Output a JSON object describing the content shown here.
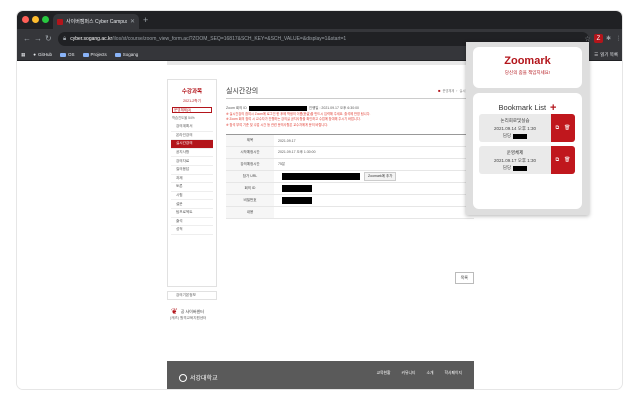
{
  "browser": {
    "tab_title": "사이버캠퍼스 Cyber Campus Syst",
    "url_host": "cyber.sogang.ac.kr",
    "url_path": "/ilos/st/course/zoom_view_form.acl?ZOOM_SEQ=16817&SCH_KEY=&SCH_VALUE=&display=1&start=1",
    "bookmarks": [
      "GitHub",
      "OS",
      "Projects",
      "Sogang"
    ],
    "reading_list": "읽기 목록"
  },
  "sidebar": {
    "title": "수강과목",
    "year_label": "2021-2학기",
    "course_select": "운영체제(3)",
    "sub": "학습진도율 54%",
    "items": [
      "강의계획서",
      "온라인강의",
      "실시간강의",
      "공지사항",
      "강의자료",
      "질의응답",
      "과제",
      "토론",
      "시험",
      "설문",
      "팀프로젝트",
      "출석",
      "성적"
    ],
    "active_index": 2,
    "box2": "강의기본정보",
    "cyber_title": "공 사이버센터",
    "cyber_sub": "(캐츠)  원격교육지원센터"
  },
  "content": {
    "title": "실시간강의",
    "crumbs": [
      "운영체제",
      "실시간강의"
    ],
    "zoom_prefix": "Zoom 회의 ID",
    "zoom_suffix": "진행일 : 2021.09.17 오후 6:30:00",
    "notes": [
      "※ 실시간강의 참여시 Zoom에 로그인 한 후에 학생의 이름(한글)을 반드시 입력해 주세요. 출석에 반영 됩니다.",
      "※ Zoom 회의 참여 시 교수자가 진행하는 강의실 공지사항을 확인하고 수업에 참여해 주시기 바랍니다.",
      "※ 참석 부여 기준 및 수업 시간 등 관련 문의사항은 교수자에게 문의 바랍니다."
    ],
    "rows": [
      {
        "label": "제목",
        "value": "2021.09.17"
      },
      {
        "label": "시작예정시간",
        "value": "2021.09.17 오후 1:30:00"
      },
      {
        "label": "강의예정시간",
        "value": "75분"
      },
      {
        "label": "참가 URL",
        "value": ""
      },
      {
        "label": "회의 ID",
        "value": ""
      },
      {
        "label": "비밀번호",
        "value": ""
      },
      {
        "label": "내용",
        "value": ""
      }
    ],
    "zoom_add": "Zoomark에 추가",
    "list_button": "목록"
  },
  "footer": {
    "logo": "서강대학교",
    "links": [
      "교육현황",
      "커뮤니티",
      "소개",
      "학사페이지"
    ]
  },
  "zoomark": {
    "title": "Zoomark",
    "subtitle": "당신의 줌을 책임지세요!",
    "list_title": "Bookmark List",
    "items": [
      {
        "name": "논리회로및실습",
        "datetime": "2021.09.14 오후 1:30",
        "host_label": "담당"
      },
      {
        "name": "운영체제",
        "datetime": "2021.09.17 오후 1:30",
        "host_label": "담당"
      }
    ]
  }
}
